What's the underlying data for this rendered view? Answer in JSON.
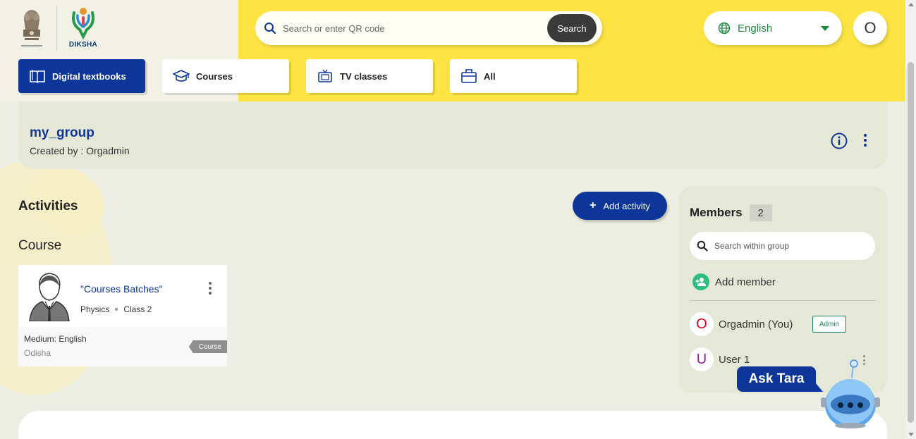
{
  "header": {
    "logo_text": "DIKSHA",
    "search": {
      "placeholder": "Search or enter QR code",
      "button_label": "Search"
    },
    "language": {
      "selected": "English"
    },
    "user_initial": "O"
  },
  "tabs": [
    {
      "label": "Digital textbooks",
      "icon": "book-icon",
      "active": true
    },
    {
      "label": "Courses",
      "icon": "graduation-cap-icon",
      "active": false
    },
    {
      "label": "TV classes",
      "icon": "tv-icon",
      "active": false
    },
    {
      "label": "All",
      "icon": "bag-icon",
      "active": false
    }
  ],
  "group": {
    "title": "my_group",
    "created_by": "Created by : Orgadmin"
  },
  "activities": {
    "heading": "Activities",
    "add_label": "Add activity",
    "section_heading": "Course",
    "card": {
      "title": "\"Courses Batches\"",
      "subject": "Physics",
      "grade": "Class 2",
      "medium": "Medium: English",
      "board": "Odisha",
      "badge": "Course"
    }
  },
  "members": {
    "title": "Members",
    "count": "2",
    "search_placeholder": "Search within group",
    "add_label": "Add member",
    "list": [
      {
        "initial": "O",
        "name": "Orgadmin (You)",
        "badge": "Admin",
        "color": "#e0001b"
      },
      {
        "initial": "U",
        "name": "User 1",
        "color": "#8b1e9c"
      }
    ]
  },
  "assistant": {
    "label": "Ask Tara"
  },
  "colors": {
    "primary": "#0c3699",
    "yellow": "#fde443",
    "green": "#1b8a3c"
  }
}
